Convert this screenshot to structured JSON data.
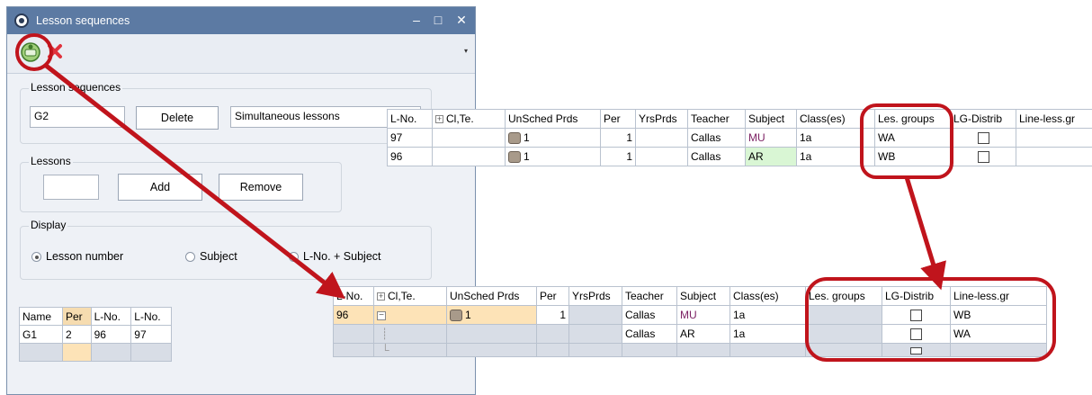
{
  "window": {
    "title": "Lesson sequences",
    "minimize": "–",
    "maximize": "□",
    "close": "✕"
  },
  "toolbar": {
    "dropdown": "▾"
  },
  "lesson_sequences": {
    "label": "Lesson sequences",
    "value": "G2",
    "delete_label": "Delete",
    "type_value": "Simultaneous lessons"
  },
  "lessons": {
    "label": "Lessons",
    "value": "",
    "add_label": "Add",
    "remove_label": "Remove"
  },
  "display": {
    "label": "Display",
    "options": [
      "Lesson number",
      "Subject",
      "L-No. + Subject"
    ],
    "selected": "Lesson number"
  },
  "seq_grid": {
    "headers": [
      "Name",
      "Per",
      "L-No.",
      "L-No."
    ],
    "rows": [
      [
        "G1",
        "2",
        "96",
        "97"
      ]
    ]
  },
  "top_table": {
    "headers": [
      "L-No.",
      "Cl,Te.",
      "UnSched Prds",
      "Per",
      "YrsPrds",
      "Teacher",
      "Subject",
      "Class(es)",
      "Les. groups",
      "LG-Distrib",
      "Line-less.gr"
    ],
    "rows": [
      {
        "lno": "97",
        "unsched": "1",
        "per": "1",
        "teacher": "Callas",
        "subject": "MU",
        "classes": "1a",
        "lesgroups": "WA"
      },
      {
        "lno": "96",
        "unsched": "1",
        "per": "1",
        "teacher": "Callas",
        "subject": "AR",
        "classes": "1a",
        "lesgroups": "WB"
      }
    ]
  },
  "bottom_table": {
    "headers": [
      "L-No.",
      "Cl,Te.",
      "UnSched Prds",
      "Per",
      "YrsPrds",
      "Teacher",
      "Subject",
      "Class(es)",
      "Les. groups",
      "LG-Distrib",
      "Line-less.gr"
    ],
    "rows": [
      {
        "lno": "96",
        "unsched": "1",
        "per": "1",
        "teacher": "Callas",
        "subject": "MU",
        "classes": "1a",
        "lineless": "WB"
      },
      {
        "lno": "",
        "unsched": "",
        "per": "",
        "teacher": "Callas",
        "subject": "AR",
        "classes": "1a",
        "lineless": "WA"
      }
    ]
  },
  "colors": {
    "annotation": "#c0141c",
    "titlebar": "#5c7aa3",
    "selected_row": "#fde3b7",
    "subject_green": "#d9f6d4"
  }
}
